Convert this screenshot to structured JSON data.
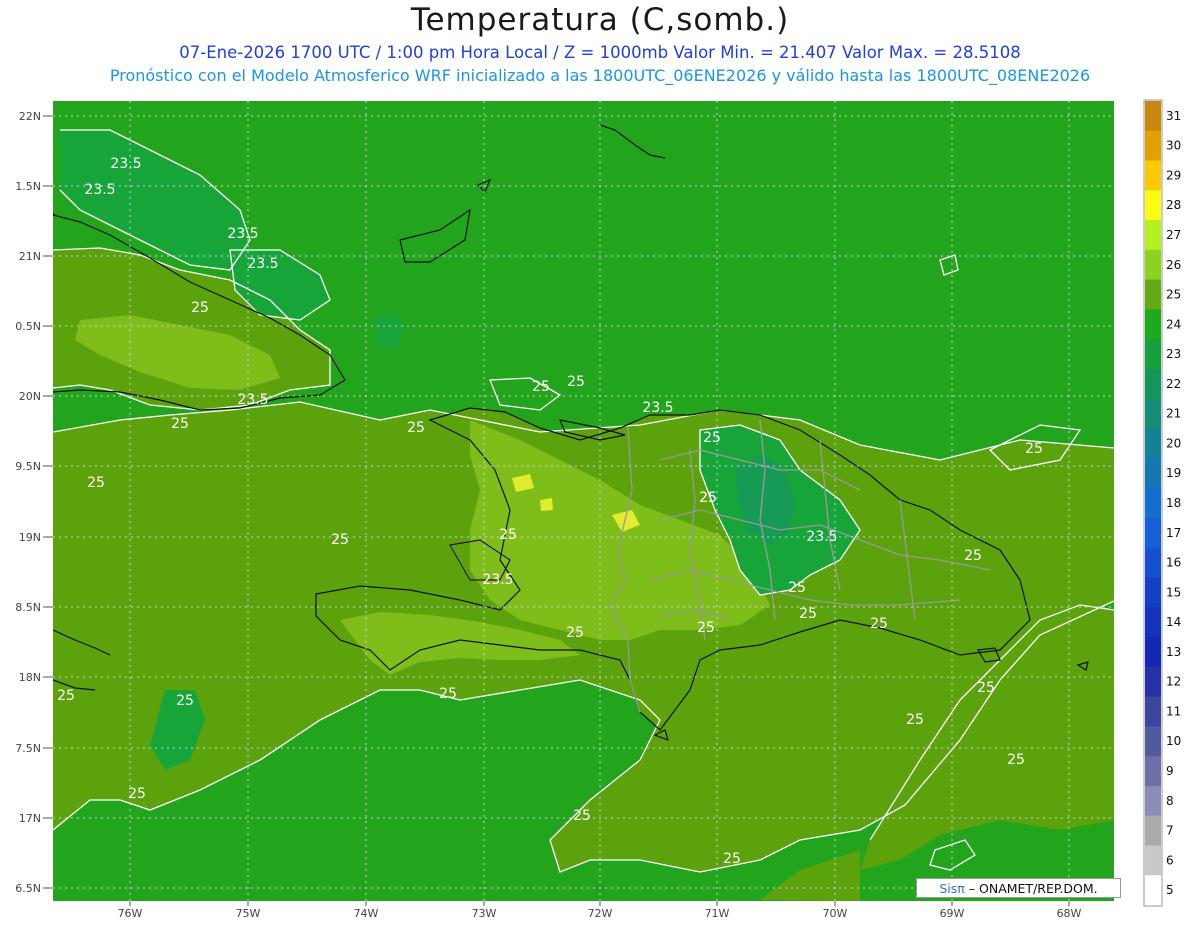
{
  "header": {
    "title": "Temperatura (C,somb.)",
    "line1": "07-Ene-2026  1700 UTC / 1:00 pm Hora Local / Z = 1000mb    Valor Min. = 21.407  Valor Max. = 28.5108",
    "line2": "Pronóstico con el Modelo Atmosferico WRF inicializado a las 1800UTC_06ENE2026 y válido hasta las  1800UTC_08ENE2026"
  },
  "map": {
    "lat_labels": [
      "22N",
      "1.5N",
      "21N",
      "0.5N",
      "20N",
      "9.5N",
      "19N",
      "8.5N",
      "18N",
      "7.5N",
      "17N",
      "6.5N"
    ],
    "lon_labels": [
      "76W",
      "75W",
      "74W",
      "73W",
      "72W",
      "71W",
      "70W",
      "69W",
      "68W"
    ],
    "contour_labels": [
      "23.5",
      "23.5",
      "23.5",
      "23.5",
      "25",
      "23.5",
      "25",
      "25",
      "25",
      "25",
      "25",
      "23.5",
      "25",
      "25",
      "25",
      "25",
      "23.5",
      "23.5",
      "25",
      "25",
      "25",
      "25",
      "25",
      "25",
      "25",
      "25",
      "25",
      "25",
      "25",
      "25",
      "25",
      "25",
      "25",
      "25"
    ],
    "colors": {
      "sea": "#22a51c",
      "band_24_25": "#27a51d",
      "band_25_26": "#5ca20d",
      "band_26_27": "#7fbd1b",
      "band_27_28": "#b6e52a",
      "band_28_29": "#e2ec2e",
      "band_23_24": "#17a53a",
      "band_22_23": "#169a55",
      "coast": "#111111",
      "borders": "#9a9a9a",
      "contour": "#ffffff"
    }
  },
  "colorbar": {
    "labels": [
      "31",
      "30",
      "29",
      "28",
      "27",
      "26",
      "25",
      "24",
      "23",
      "22",
      "21",
      "20",
      "19",
      "18",
      "17",
      "16",
      "15",
      "14",
      "13",
      "12",
      "11",
      "10",
      "9",
      "8",
      "7",
      "6",
      "5"
    ],
    "colors": [
      "#c8860a",
      "#e4a000",
      "#fcc800",
      "#fffa14",
      "#b4f01e",
      "#8cd21e",
      "#64aa14",
      "#1eaa1e",
      "#14a03c",
      "#14965a",
      "#148c78",
      "#148296",
      "#1478b4",
      "#146ed2",
      "#1460d8",
      "#1450d0",
      "#1440c8",
      "#1432c0",
      "#1428b4",
      "#2832a8",
      "#3c46a0",
      "#505aa0",
      "#6e6ea8",
      "#8c8cb4",
      "#aaaaaa",
      "#c8c8c8",
      "#ffffff"
    ]
  },
  "credit": {
    "brand": "Sisπ",
    "text": "– ONAMET/REP.DOM."
  }
}
